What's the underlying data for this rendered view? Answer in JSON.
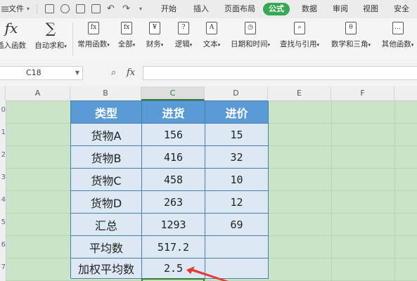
{
  "menubar": {
    "file_label": "文件",
    "tabs": [
      "开始",
      "插入",
      "页面布局",
      "公式",
      "数据",
      "审阅",
      "视图",
      "安全"
    ],
    "active_tab": "公式",
    "accent": "#34a853"
  },
  "ribbon": {
    "items": [
      {
        "label": "插入函数",
        "icon": "fx-icon",
        "glyph": "fx"
      },
      {
        "label": "自动求和",
        "icon": "sum-icon",
        "glyph": "∑"
      },
      {
        "label": "常用函数",
        "icon": "common-function-icon",
        "glyph": "fx"
      },
      {
        "label": "全部",
        "icon": "all-functions-icon",
        "glyph": "fx"
      },
      {
        "label": "财务",
        "icon": "finance-icon",
        "glyph": "¥"
      },
      {
        "label": "逻辑",
        "icon": "logic-icon",
        "glyph": "?"
      },
      {
        "label": "文本",
        "icon": "text-icon",
        "glyph": "A"
      },
      {
        "label": "日期和时间",
        "icon": "clock-icon",
        "glyph": "◷"
      },
      {
        "label": "查找与引用",
        "icon": "lookup-icon",
        "glyph": "⌕"
      },
      {
        "label": "数学和三角",
        "icon": "math-trig-icon",
        "glyph": "θ"
      },
      {
        "label": "其他函数",
        "icon": "more-functions-icon",
        "glyph": "…"
      }
    ]
  },
  "formula_bar": {
    "cell_ref": "C18",
    "fx_label": "fx",
    "formula": ""
  },
  "columns": [
    "A",
    "B",
    "C",
    "D",
    "E",
    "F"
  ],
  "selected_column": "C",
  "rows": [
    "0",
    "1",
    "2",
    "3",
    "4",
    "5",
    "6",
    "7"
  ],
  "table": {
    "headers": [
      "类型",
      "进货",
      "进价"
    ],
    "rows": [
      [
        "货物A",
        "156",
        "15"
      ],
      [
        "货物B",
        "416",
        "32"
      ],
      [
        "货物C",
        "458",
        "10"
      ],
      [
        "货物D",
        "263",
        "12"
      ],
      [
        "汇总",
        "1293",
        "69"
      ],
      [
        "平均数",
        "517.2",
        ""
      ],
      [
        "加权平均数",
        "2.5",
        ""
      ]
    ]
  },
  "colors": {
    "header_fill": "#5b9bd5",
    "cell_fill": "#dce9f5",
    "sheet_bg": "#c9e4c9",
    "arrow": "#e53935"
  }
}
